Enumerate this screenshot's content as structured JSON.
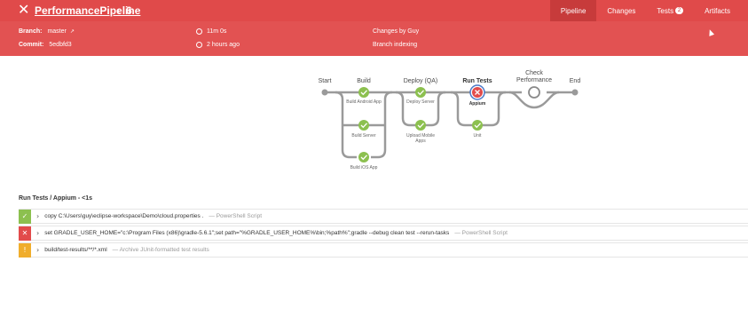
{
  "header": {
    "title": "PerformancePipeline",
    "run_separator": "‹",
    "run_number": "6",
    "tabs": [
      {
        "label": "Pipeline",
        "active": true
      },
      {
        "label": "Changes",
        "active": false
      },
      {
        "label": "Tests",
        "active": false,
        "badge": "2"
      },
      {
        "label": "Artifacts",
        "active": false
      }
    ],
    "accent_color": "#e04a4a"
  },
  "meta": {
    "branch_label": "Branch:",
    "branch_value": "master",
    "commit_label": "Commit:",
    "commit_value": "5edbfd3",
    "duration": "11m 0s",
    "time_ago": "2 hours ago",
    "changes": "Changes by Guy",
    "cause": "Branch indexing"
  },
  "graph": {
    "start_label": "Start",
    "end_label": "End",
    "stages": [
      {
        "label": "Build",
        "nodes": [
          "Build Android App",
          "Build Server",
          "Build iOS App"
        ]
      },
      {
        "label": "Deploy (QA)",
        "nodes": [
          "Deploy Server",
          "Upload Mobile Apps"
        ]
      },
      {
        "label": "Run Tests",
        "nodes": [
          "Appium",
          "Unit"
        ]
      },
      {
        "label": "Check Performance",
        "nodes": []
      }
    ]
  },
  "steps": {
    "title": "Run Tests / Appium - <1s",
    "items": [
      {
        "status": "success",
        "command": "copy C:\\Users\\guy\\eclipse-workspace\\Demo\\cloud.properties .",
        "type": "— PowerShell Script"
      },
      {
        "status": "failed",
        "command": "set GRADLE_USER_HOME=\"c:\\Program Files (x86)\\gradle-5.6.1\";set path=\"%GRADLE_USER_HOME%\\bin;%path%\";gradle --debug clean test --rerun-tasks",
        "type": "— PowerShell Script"
      },
      {
        "status": "unstable",
        "command": "build/test-results/**/*.xml",
        "type": "— Archive JUnit-formatted test results"
      }
    ]
  },
  "colors": {
    "success": "#8cc04f",
    "failed": "#e24b4b",
    "unstable": "#f0ad2c",
    "track": "#9a9a9a"
  }
}
